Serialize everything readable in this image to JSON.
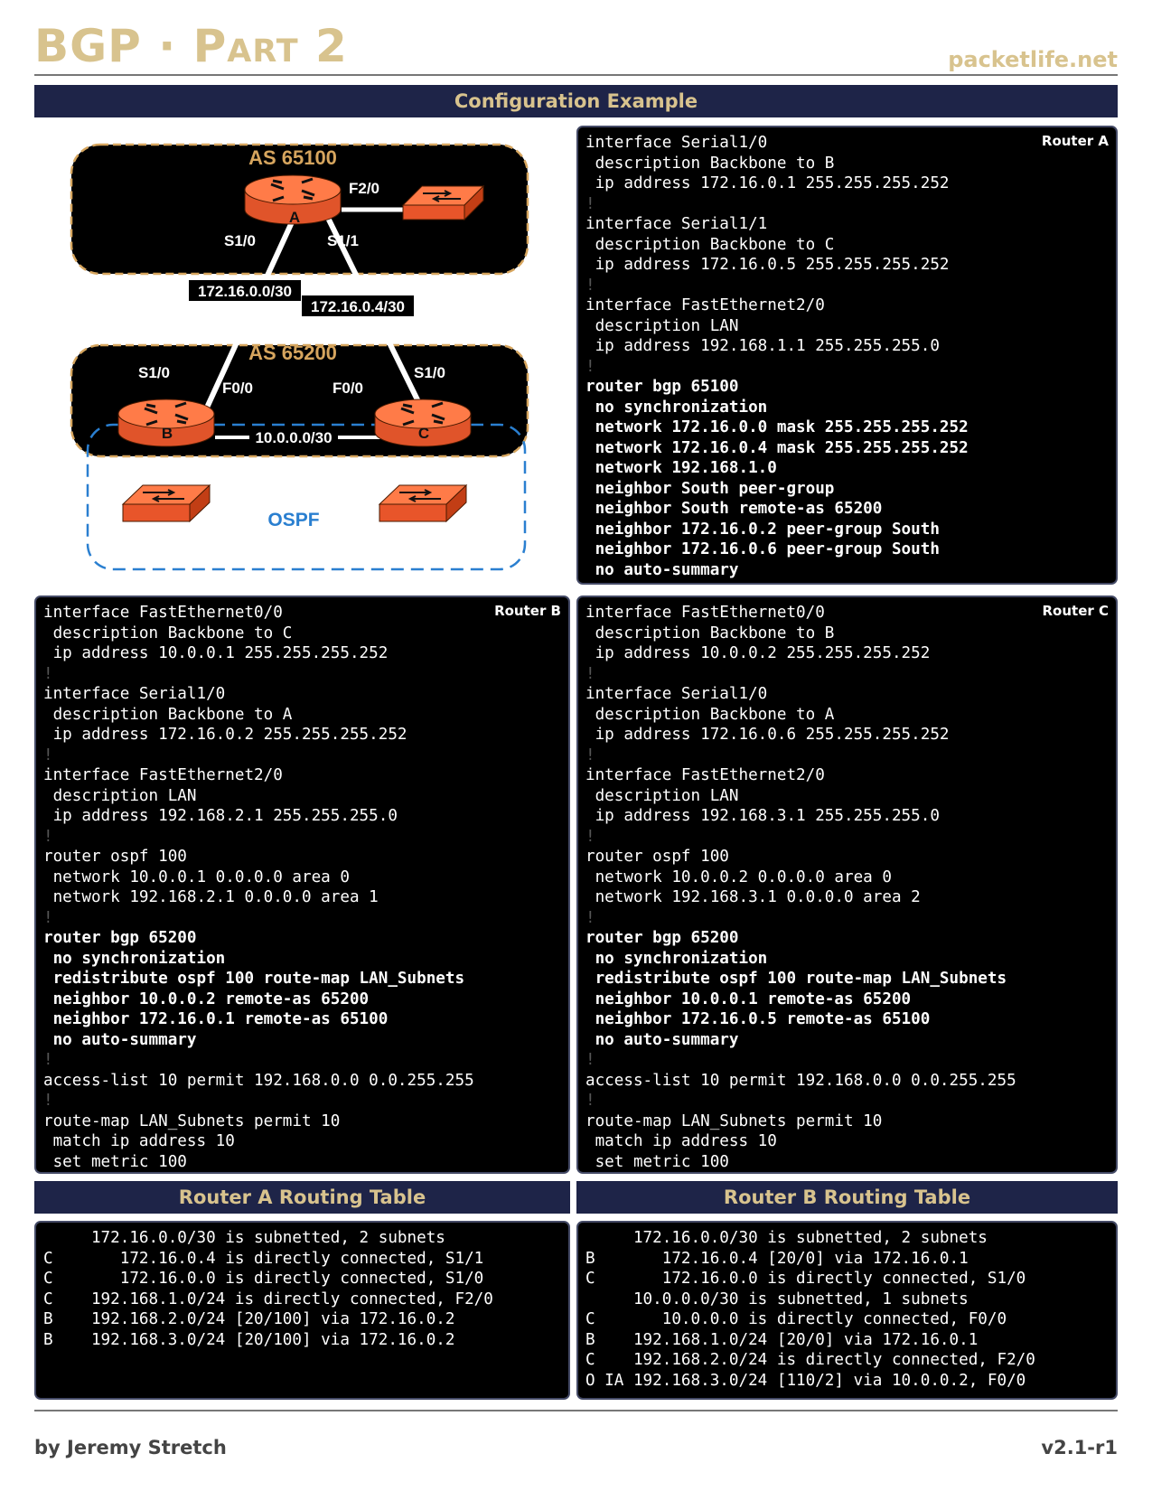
{
  "header": {
    "title_first": "BGP · ",
    "title_second": "Part 2",
    "site": "packetlife.net",
    "section_bar": "Configuration Example"
  },
  "diagram": {
    "as_top": "AS 65100",
    "as_bottom": "AS 65200",
    "ospf": "OSPF",
    "router_a": "A",
    "router_b": "B",
    "router_c": "C",
    "a_f20": "F2/0",
    "a_s10": "S1/0",
    "a_s11": "S1/1",
    "link_ab": "172.16.0.0/30",
    "link_ac": "172.16.0.4/30",
    "b_s10": "S1/0",
    "c_s10": "S1/0",
    "b_f00": "F0/0",
    "c_f00": "F0/0",
    "link_bc": "10.0.0.0/30"
  },
  "router_a": {
    "label": "Router A",
    "lines": [
      {
        "t": "interface Serial1/0",
        "k": "n"
      },
      {
        "t": " description Backbone to B",
        "k": "n"
      },
      {
        "t": " ip address 172.16.0.1 255.255.255.252",
        "k": "n"
      },
      {
        "t": "!",
        "k": "s"
      },
      {
        "t": "interface Serial1/1",
        "k": "n"
      },
      {
        "t": " description Backbone to C",
        "k": "n"
      },
      {
        "t": " ip address 172.16.0.5 255.255.255.252",
        "k": "n"
      },
      {
        "t": "!",
        "k": "s"
      },
      {
        "t": "interface FastEthernet2/0",
        "k": "n"
      },
      {
        "t": " description LAN",
        "k": "n"
      },
      {
        "t": " ip address 192.168.1.1 255.255.255.0",
        "k": "n"
      },
      {
        "t": "!",
        "k": "s"
      },
      {
        "t": "router bgp 65100",
        "k": "b"
      },
      {
        "t": " no synchronization",
        "k": "b"
      },
      {
        "t": " network 172.16.0.0 mask 255.255.255.252",
        "k": "b"
      },
      {
        "t": " network 172.16.0.4 mask 255.255.255.252",
        "k": "b"
      },
      {
        "t": " network 192.168.1.0",
        "k": "b"
      },
      {
        "t": " neighbor South peer-group",
        "k": "b"
      },
      {
        "t": " neighbor South remote-as 65200",
        "k": "b"
      },
      {
        "t": " neighbor 172.16.0.2 peer-group South",
        "k": "b"
      },
      {
        "t": " neighbor 172.16.0.6 peer-group South",
        "k": "b"
      },
      {
        "t": " no auto-summary",
        "k": "b"
      }
    ]
  },
  "router_b": {
    "label": "Router B",
    "lines": [
      {
        "t": "interface FastEthernet0/0",
        "k": "n"
      },
      {
        "t": " description Backbone to C",
        "k": "n"
      },
      {
        "t": " ip address 10.0.0.1 255.255.255.252",
        "k": "n"
      },
      {
        "t": "!",
        "k": "s"
      },
      {
        "t": "interface Serial1/0",
        "k": "n"
      },
      {
        "t": " description Backbone to A",
        "k": "n"
      },
      {
        "t": " ip address 172.16.0.2 255.255.255.252",
        "k": "n"
      },
      {
        "t": "!",
        "k": "s"
      },
      {
        "t": "interface FastEthernet2/0",
        "k": "n"
      },
      {
        "t": " description LAN",
        "k": "n"
      },
      {
        "t": " ip address 192.168.2.1 255.255.255.0",
        "k": "n"
      },
      {
        "t": "!",
        "k": "s"
      },
      {
        "t": "router ospf 100",
        "k": "n"
      },
      {
        "t": " network 10.0.0.1 0.0.0.0 area 0",
        "k": "n"
      },
      {
        "t": " network 192.168.2.1 0.0.0.0 area 1",
        "k": "n"
      },
      {
        "t": "!",
        "k": "s"
      },
      {
        "t": "router bgp 65200",
        "k": "b"
      },
      {
        "t": " no synchronization",
        "k": "b"
      },
      {
        "t": " redistribute ospf 100 route-map LAN_Subnets",
        "k": "b"
      },
      {
        "t": " neighbor 10.0.0.2 remote-as 65200",
        "k": "b"
      },
      {
        "t": " neighbor 172.16.0.1 remote-as 65100",
        "k": "b"
      },
      {
        "t": " no auto-summary",
        "k": "b"
      },
      {
        "t": "!",
        "k": "s"
      },
      {
        "t": "access-list 10 permit 192.168.0.0 0.0.255.255",
        "k": "n"
      },
      {
        "t": "!",
        "k": "s"
      },
      {
        "t": "route-map LAN_Subnets permit 10",
        "k": "n"
      },
      {
        "t": " match ip address 10",
        "k": "n"
      },
      {
        "t": " set metric 100",
        "k": "n"
      }
    ]
  },
  "router_c": {
    "label": "Router C",
    "lines": [
      {
        "t": "interface FastEthernet0/0",
        "k": "n"
      },
      {
        "t": " description Backbone to B",
        "k": "n"
      },
      {
        "t": " ip address 10.0.0.2 255.255.255.252",
        "k": "n"
      },
      {
        "t": "!",
        "k": "s"
      },
      {
        "t": "interface Serial1/0",
        "k": "n"
      },
      {
        "t": " description Backbone to A",
        "k": "n"
      },
      {
        "t": " ip address 172.16.0.6 255.255.255.252",
        "k": "n"
      },
      {
        "t": "!",
        "k": "s"
      },
      {
        "t": "interface FastEthernet2/0",
        "k": "n"
      },
      {
        "t": " description LAN",
        "k": "n"
      },
      {
        "t": " ip address 192.168.3.1 255.255.255.0",
        "k": "n"
      },
      {
        "t": "!",
        "k": "s"
      },
      {
        "t": "router ospf 100",
        "k": "n"
      },
      {
        "t": " network 10.0.0.2 0.0.0.0 area 0",
        "k": "n"
      },
      {
        "t": " network 192.168.3.1 0.0.0.0 area 2",
        "k": "n"
      },
      {
        "t": "!",
        "k": "s"
      },
      {
        "t": "router bgp 65200",
        "k": "b"
      },
      {
        "t": " no synchronization",
        "k": "b"
      },
      {
        "t": " redistribute ospf 100 route-map LAN_Subnets",
        "k": "b"
      },
      {
        "t": " neighbor 10.0.0.1 remote-as 65200",
        "k": "b"
      },
      {
        "t": " neighbor 172.16.0.5 remote-as 65100",
        "k": "b"
      },
      {
        "t": " no auto-summary",
        "k": "b"
      },
      {
        "t": "!",
        "k": "s"
      },
      {
        "t": "access-list 10 permit 192.168.0.0 0.0.255.255",
        "k": "n"
      },
      {
        "t": "!",
        "k": "s"
      },
      {
        "t": "route-map LAN_Subnets permit 10",
        "k": "n"
      },
      {
        "t": " match ip address 10",
        "k": "n"
      },
      {
        "t": " set metric 100",
        "k": "n"
      }
    ]
  },
  "table_a": {
    "title": "Router A Routing Table",
    "lines": [
      {
        "t": "     172.16.0.0/30 is subnetted, 2 subnets",
        "k": "n"
      },
      {
        "t": "C       172.16.0.4 is directly connected, S1/1",
        "k": "n"
      },
      {
        "t": "C       172.16.0.0 is directly connected, S1/0",
        "k": "n"
      },
      {
        "t": "C    192.168.1.0/24 is directly connected, F2/0",
        "k": "n"
      },
      {
        "t": "B    192.168.2.0/24 [20/100] via 172.16.0.2",
        "k": "n"
      },
      {
        "t": "B    192.168.3.0/24 [20/100] via 172.16.0.2",
        "k": "n"
      }
    ]
  },
  "table_b": {
    "title": "Router B Routing Table",
    "lines": [
      {
        "t": "     172.16.0.0/30 is subnetted, 2 subnets",
        "k": "n"
      },
      {
        "t": "B       172.16.0.4 [20/0] via 172.16.0.1",
        "k": "n"
      },
      {
        "t": "C       172.16.0.0 is directly connected, S1/0",
        "k": "n"
      },
      {
        "t": "     10.0.0.0/30 is subnetted, 1 subnets",
        "k": "n"
      },
      {
        "t": "C       10.0.0.0 is directly connected, F0/0",
        "k": "n"
      },
      {
        "t": "B    192.168.1.0/24 [20/0] via 172.16.0.1",
        "k": "n"
      },
      {
        "t": "C    192.168.2.0/24 is directly connected, F2/0",
        "k": "n"
      },
      {
        "t": "O IA 192.168.3.0/24 [110/2] via 10.0.0.2, F0/0",
        "k": "n"
      }
    ]
  },
  "footer": {
    "author": "by Jeremy Stretch",
    "version": "v2.1-r1"
  }
}
